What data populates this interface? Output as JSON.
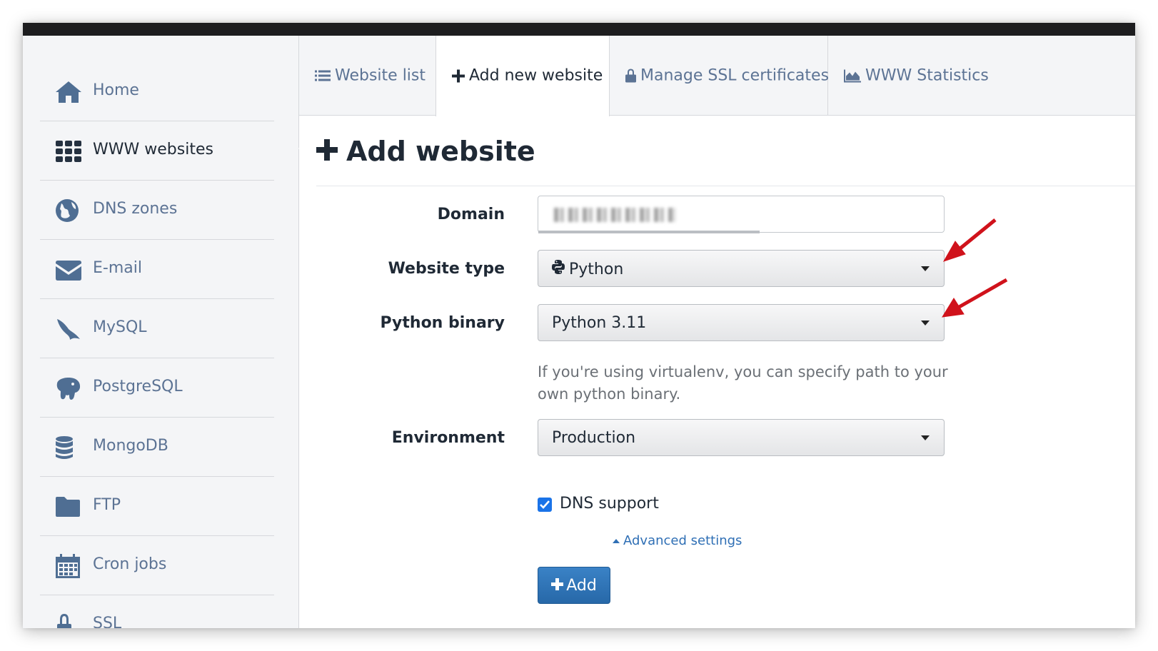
{
  "sidebar": {
    "items": [
      {
        "label": "Home",
        "icon": "home-icon"
      },
      {
        "label": "WWW websites",
        "icon": "grid-icon",
        "active": true
      },
      {
        "label": "DNS zones",
        "icon": "globe-icon"
      },
      {
        "label": "E-mail",
        "icon": "envelope-icon"
      },
      {
        "label": "MySQL",
        "icon": "dolphin-icon"
      },
      {
        "label": "PostgreSQL",
        "icon": "elephant-icon"
      },
      {
        "label": "MongoDB",
        "icon": "database-icon"
      },
      {
        "label": "FTP",
        "icon": "folder-icon"
      },
      {
        "label": "Cron jobs",
        "icon": "calendar-icon"
      },
      {
        "label": "SSL",
        "icon": "lock-icon"
      }
    ]
  },
  "tabs": [
    {
      "label": "Website list",
      "icon": "list-icon"
    },
    {
      "label": "Add new website",
      "icon": "plus-icon",
      "active": true
    },
    {
      "label": "Manage SSL certificates",
      "icon": "lock-icon"
    },
    {
      "label": "WWW Statistics",
      "icon": "area-chart-icon"
    }
  ],
  "form": {
    "title": "Add website",
    "domain": {
      "label": "Domain",
      "value_redacted": true
    },
    "website_type": {
      "label": "Website type",
      "value": "Python"
    },
    "python_binary": {
      "label": "Python binary",
      "value": "Python 3.11",
      "help": "If you're using virtualenv, you can specify path to your own python binary."
    },
    "environment": {
      "label": "Environment",
      "value": "Production"
    },
    "dns_support": {
      "label": "DNS support",
      "checked": true
    },
    "advanced_link": "Advanced settings",
    "submit_label": "Add"
  },
  "colors": {
    "accent": "#2f6fb5",
    "button": "#2a6fb3",
    "annotation_arrow": "#d0121b",
    "checkbox": "#1a73e8"
  }
}
